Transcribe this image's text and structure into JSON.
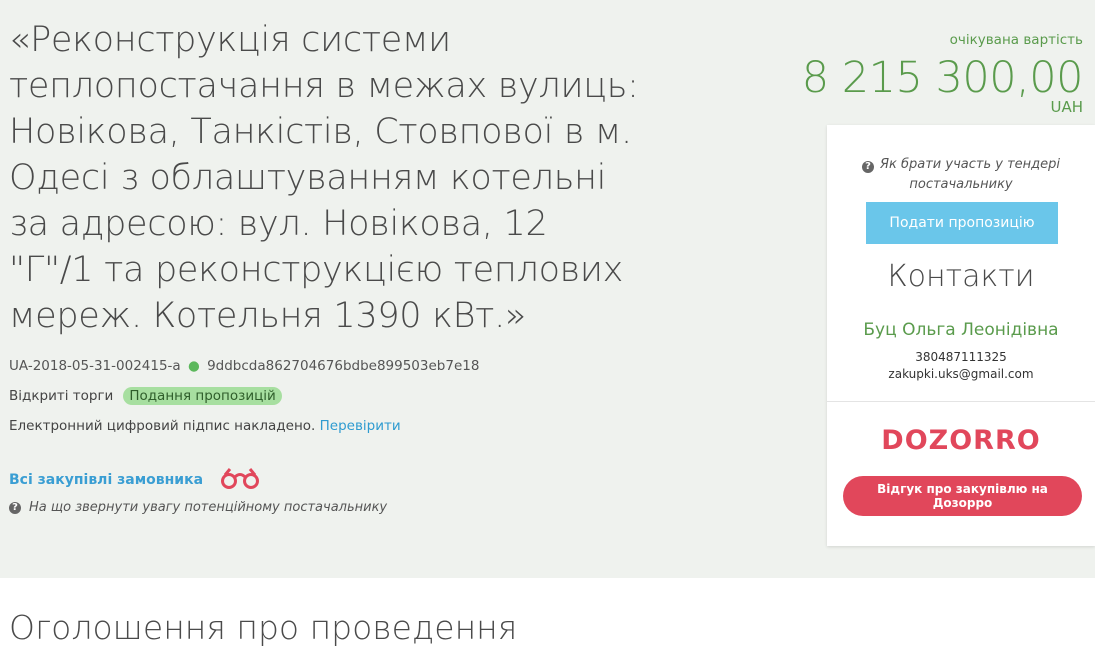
{
  "tender": {
    "title": "«Реконструкція системи теплопостачання в межах вулиць: Новікова, Танкістів, Стовпової в м. Одесі з облаштуванням котельні за адресою: вул. Новікова, 12 \"Г\"/1 та реконструкцією теплових мереж. Котельня 1390 кВт.»",
    "tender_id": "UA-2018-05-31-002415-a",
    "hash": "9ddbcda862704676bdbe899503eb7e18",
    "procedure_type": "Відкриті торги",
    "status_badge": "Подання пропозицій",
    "signature_text": "Електронний цифровий підпис накладено.",
    "signature_check_link": "Перевірити",
    "all_purchases_link": "Всі закупівлі замовника",
    "supplier_attention": "На що звернути увагу потенційному постачальнику"
  },
  "value": {
    "label": "очікувана вартість",
    "amount": "8 215 300,00",
    "currency": "UAH"
  },
  "sidebar": {
    "how_to_participate": "Як брати участь у тендері постачальнику",
    "submit_button": "Подати пропозицію",
    "contacts_title": "Контакти",
    "contact_name": "Буц Ольга Леонідівна",
    "contact_phone": "380487111325",
    "contact_email": "zakupki.uks@gmail.com",
    "dozorro_logo": "DOZORRO",
    "dozorro_button": "Відгук про закупівлю на Дозорро"
  },
  "section": {
    "announcement_title": "Оголошення про проведення"
  },
  "colors": {
    "hero_bg": "#eff2ee",
    "accent_green": "#5a9b4c",
    "link_blue": "#2e9bd0",
    "submit_blue": "#6ac6ea",
    "dozorro_red": "#e1475b",
    "badge_green": "#a7dfa0"
  },
  "icons": {
    "question": "question-circle-icon",
    "binoculars": "binoculars-icon"
  }
}
